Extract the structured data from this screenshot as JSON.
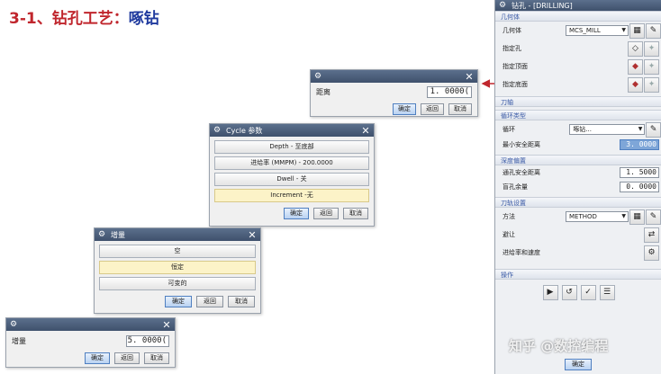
{
  "slide": {
    "title": "3-1、钻孔工艺：",
    "subtitle": "啄钻"
  },
  "distance_dialog": {
    "label": "距离",
    "value": "1. 0000(",
    "ok": "确定",
    "back": "返回",
    "cancel": "取消"
  },
  "cycle_dialog": {
    "title": "Cycle 参数",
    "options": [
      "Depth - 至底部",
      "进给率 (MMPM) - 200.0000",
      "Dwell - 关",
      "Increment -无"
    ],
    "ok": "确定",
    "back": "返回",
    "cancel": "取消"
  },
  "increment_dialog": {
    "title": "增量",
    "options": [
      "空",
      "恒定",
      "可变的"
    ],
    "ok": "确定",
    "back": "返回",
    "cancel": "取消"
  },
  "step_dialog": {
    "label": "增量",
    "value": "5. 0000(",
    "ok": "确定",
    "back": "返回",
    "cancel": "取消"
  },
  "panel": {
    "title": "钻孔 - [DRILLING]",
    "geometry": {
      "header": "几何体",
      "geometry_label": "几何体",
      "geometry_value": "MCS_MILL",
      "specify_holes": "指定孔",
      "specify_top": "指定顶面",
      "specify_bottom": "指定底面"
    },
    "tool_header": "刀轴",
    "cycle": {
      "header": "循环类型",
      "cycle_label": "循环",
      "cycle_value": "啄钻...",
      "min_clearance_label": "最小安全距离",
      "min_clearance_value": "3. 0000"
    },
    "depth": {
      "header": "深度偏置",
      "through_label": "通孔安全距离",
      "through_value": "1. 5000",
      "blind_label": "盲孔余量",
      "blind_value": "0. 0000"
    },
    "path": {
      "header": "刀轨设置",
      "method_label": "方法",
      "method_value": "METHOD",
      "avoid_label": "避让",
      "feeds_label": "进给率和速度"
    },
    "ops_header": "操作",
    "ok": "确定"
  },
  "watermark": "知乎 @数控编程",
  "colors": {
    "title_red": "#c0262d",
    "title_blue": "#1f3a9e",
    "titlebar": "#4a5d7a",
    "selected": "#fcf3c8",
    "highlight": "#7ea6d8",
    "arrow": "#c0262d"
  }
}
